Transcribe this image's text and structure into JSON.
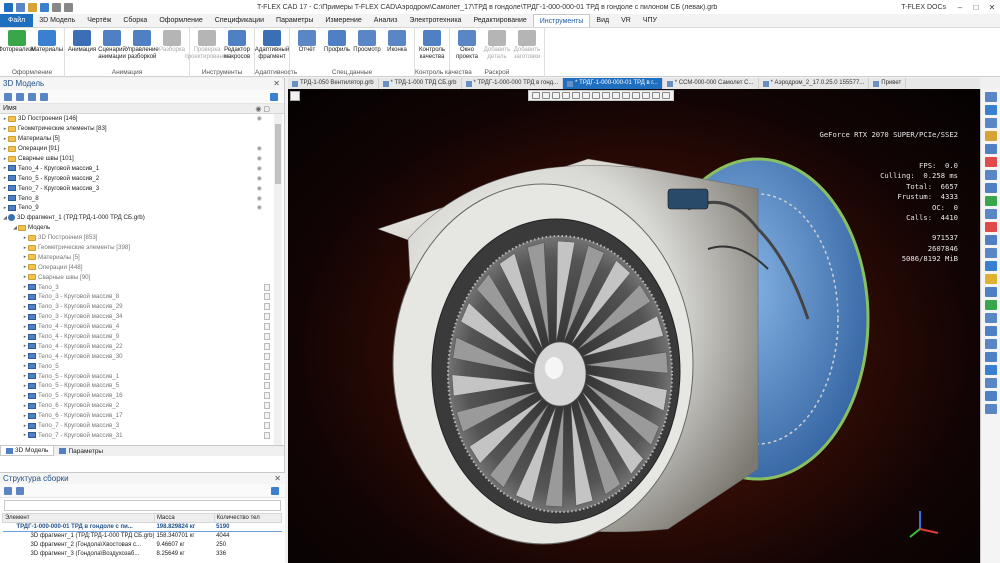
{
  "window": {
    "title": "T-FLEX CAD 17 - C:\\Примеры T-FLEX CAD\\Аэродром\\Самолет_17\\ТРД в гондоле\\ТРДГ-1-000-000-01 ТРД в гондоле с пилоном СБ (левак).grb",
    "docs_label": "T-FLEX DOCs",
    "minimize": "–",
    "maximize": "□",
    "close": "✕"
  },
  "ribbon_tabs": [
    "Файл",
    "3D Модель",
    "Чертёж",
    "Сборка",
    "Оформление",
    "Спецификации",
    "Параметры",
    "Измерение",
    "Анализ",
    "Электротехника",
    "Редактирование",
    "Инструменты",
    "Вид",
    "VR",
    "ЧПУ"
  ],
  "ribbon_active_tab": "Инструменты",
  "ribbon": {
    "groups": [
      {
        "name": "Оформление",
        "buttons": [
          {
            "label": "Фотореализм",
            "color": "#3aa64a"
          },
          {
            "label": "Материалы",
            "color": "#3a7fd0"
          }
        ]
      },
      {
        "name": "Анимация",
        "buttons": [
          {
            "label": "Анимация",
            "color": "#3b6fb5"
          },
          {
            "label": "Сценарий анимации",
            "color": "#4f80c4"
          },
          {
            "label": "Управление разборкой",
            "color": "#4f80c4"
          },
          {
            "label": "Разборка",
            "color": "#b5b5b5",
            "disabled": true
          }
        ]
      },
      {
        "name": "Инструменты",
        "buttons": [
          {
            "label": "Проверка проектирования",
            "color": "#b5b5b5",
            "disabled": true
          },
          {
            "label": "Редактор макросов",
            "color": "#4f80c4"
          }
        ]
      },
      {
        "name": "Адаптивность",
        "buttons": [
          {
            "label": "Адаптивный фрагмент",
            "color": "#3b6fb5"
          }
        ]
      },
      {
        "name": "Спец.данные",
        "buttons": [
          {
            "label": "Отчёт",
            "color": "#5a86c5"
          },
          {
            "label": "Профиль",
            "color": "#4f80c4"
          },
          {
            "label": "Просмотр",
            "color": "#5a86c5"
          },
          {
            "label": "Иконка",
            "color": "#5a86c5"
          }
        ]
      },
      {
        "name": "Контроль качества",
        "buttons": [
          {
            "label": "Контроль качества",
            "color": "#4f80c4"
          }
        ]
      },
      {
        "name": "Раскрой",
        "buttons": [
          {
            "label": "Окно проекта",
            "color": "#5a86c5"
          },
          {
            "label": "Добавить деталь",
            "color": "#b5b5b5",
            "disabled": true
          },
          {
            "label": "Добавить заготовки",
            "color": "#b5b5b5",
            "disabled": true
          }
        ]
      }
    ]
  },
  "left_panel": {
    "title": "3D Модель",
    "column_header": "Имя",
    "tree": [
      {
        "label": "3D Построения [146]",
        "icon": "folder",
        "indent": 0,
        "eye": true
      },
      {
        "label": "Геометрические элементы [83]",
        "icon": "folder",
        "indent": 0,
        "eye": false
      },
      {
        "label": "Материалы [5]",
        "icon": "folder",
        "indent": 0,
        "eye": false
      },
      {
        "label": "Операции [91]",
        "icon": "folder",
        "indent": 0,
        "eye": true
      },
      {
        "label": "Сварные швы [101]",
        "icon": "folder",
        "indent": 0,
        "eye": true
      },
      {
        "label": "Тело_4 - Круговой массив_1",
        "icon": "body",
        "indent": 0,
        "eye": true
      },
      {
        "label": "Тело_5 - Круговой массив_2",
        "icon": "body",
        "indent": 0,
        "eye": true
      },
      {
        "label": "Тело_7 - Круговой массив_3",
        "icon": "body",
        "indent": 0,
        "eye": true
      },
      {
        "label": "Тело_8",
        "icon": "body",
        "indent": 0,
        "eye": true
      },
      {
        "label": "Тело_9",
        "icon": "body",
        "indent": 0,
        "eye": true
      },
      {
        "label": "3D фрагмент_1 (ТРД:ТРД-1-000 ТРД СБ.grb)",
        "icon": "frag",
        "indent": 0,
        "eye": false
      },
      {
        "label": "Модель",
        "icon": "folder",
        "indent": 1,
        "eye": false
      },
      {
        "label": "3D Построения [853]",
        "icon": "folder",
        "indent": 2,
        "eye": false,
        "gray": true
      },
      {
        "label": "Геометрические элементы [398]",
        "icon": "folder",
        "indent": 2,
        "eye": false,
        "gray": true
      },
      {
        "label": "Материалы [5]",
        "icon": "folder",
        "indent": 2,
        "eye": false,
        "gray": true
      },
      {
        "label": "Операции [448]",
        "icon": "folder",
        "indent": 2,
        "eye": false,
        "gray": true
      },
      {
        "label": "Сварные швы [90]",
        "icon": "folder",
        "indent": 2,
        "eye": false,
        "gray": true
      },
      {
        "label": "Тело_3",
        "icon": "body",
        "indent": 2,
        "eye": false,
        "gray": true,
        "ctl": true
      },
      {
        "label": "Тело_3 - Круговой массив_8",
        "icon": "body",
        "indent": 2,
        "eye": false,
        "gray": true,
        "ctl": true
      },
      {
        "label": "Тело_3 - Круговой массив_29",
        "icon": "body",
        "indent": 2,
        "eye": false,
        "gray": true,
        "ctl": true
      },
      {
        "label": "Тело_3 - Круговой массив_34",
        "icon": "body",
        "indent": 2,
        "eye": false,
        "gray": true,
        "ctl": true
      },
      {
        "label": "Тело_4 - Круговой массив_4",
        "icon": "body",
        "indent": 2,
        "eye": false,
        "gray": true,
        "ctl": true
      },
      {
        "label": "Тело_4 - Круговой массив_9",
        "icon": "body",
        "indent": 2,
        "eye": false,
        "gray": true,
        "ctl": true
      },
      {
        "label": "Тело_4 - Круговой массив_22",
        "icon": "body",
        "indent": 2,
        "eye": false,
        "gray": true,
        "ctl": true
      },
      {
        "label": "Тело_4 - Круговой массив_30",
        "icon": "body",
        "indent": 2,
        "eye": false,
        "gray": true,
        "ctl": true
      },
      {
        "label": "Тело_5",
        "icon": "body",
        "indent": 2,
        "eye": false,
        "gray": true,
        "ctl": true
      },
      {
        "label": "Тело_5 - Круговой массив_1",
        "icon": "body",
        "indent": 2,
        "eye": false,
        "gray": true,
        "ctl": true
      },
      {
        "label": "Тело_5 - Круговой массив_5",
        "icon": "body",
        "indent": 2,
        "eye": false,
        "gray": true,
        "ctl": true
      },
      {
        "label": "Тело_5 - Круговой массив_16",
        "icon": "body",
        "indent": 2,
        "eye": false,
        "gray": true,
        "ctl": true
      },
      {
        "label": "Тело_6 - Круговой массив_2",
        "icon": "body",
        "indent": 2,
        "eye": false,
        "gray": true,
        "ctl": true
      },
      {
        "label": "Тело_6 - Круговой массив_17",
        "icon": "body",
        "indent": 2,
        "eye": false,
        "gray": true,
        "ctl": true
      },
      {
        "label": "Тело_7 - Круговой массив_3",
        "icon": "body",
        "indent": 2,
        "eye": false,
        "gray": true,
        "ctl": true
      },
      {
        "label": "Тело_7 - Круговой массив_31",
        "icon": "body",
        "indent": 2,
        "eye": false,
        "gray": true,
        "ctl": true
      }
    ],
    "tabs": [
      "3D Модель",
      "Параметры"
    ]
  },
  "assembly": {
    "title": "Структура сборки",
    "columns": [
      "Элемент",
      "Масса",
      "Количество тел"
    ],
    "rows": [
      {
        "element": "ТРДГ-1-000-000-01 ТРД в гондоле с пи...",
        "mass": "198.829824 кг",
        "count": "5190",
        "selected": true
      },
      {
        "element": "3D фрагмент_1 (ТРД:ТРД-1-000 ТРД СБ.grb)",
        "mass": "158.340701 кг",
        "count": "4044"
      },
      {
        "element": "3D фрагмент_2 (Гондола\\Хвостовая с...",
        "mass": "9.46607 кг",
        "count": "250"
      },
      {
        "element": "3D фрагмент_3 (Гондола\\Воздухозаб...",
        "mass": "8.25649 кг",
        "count": "336"
      }
    ]
  },
  "doc_tabs": [
    {
      "label": "ТРД-1-050 Вентилятор.grb",
      "active": false
    },
    {
      "label": "* ТРД-1-000 ТРД СБ.grb",
      "active": false
    },
    {
      "label": "* ТРДГ-1-000-000 ТРД в гонд...",
      "active": false
    },
    {
      "label": "* ТРДГ-1-000-000-01 ТРД в г...",
      "active": true
    },
    {
      "label": "* ССМ-000-000 Самолет С...",
      "active": false
    },
    {
      "label": "* Аэродром_2_17.0.25.0 155577...",
      "active": false
    },
    {
      "label": "Привет",
      "active": false
    }
  ],
  "stats": {
    "gpu": "GeForce RTX 2070 SUPER/PCIe/SSE2",
    "lines": [
      "FPS:  0.0",
      "Culling:  0.258 ms",
      "Total:  6657",
      "Frustum:  4333",
      "OC:  0",
      "Calls:  4410",
      "",
      "971537",
      "2607846",
      "5086/8192 MiB"
    ]
  },
  "colors": {
    "accent": "#1f6fc0",
    "file_tab": "#1f6fc0",
    "viewport_glow": "#8a2a10"
  }
}
